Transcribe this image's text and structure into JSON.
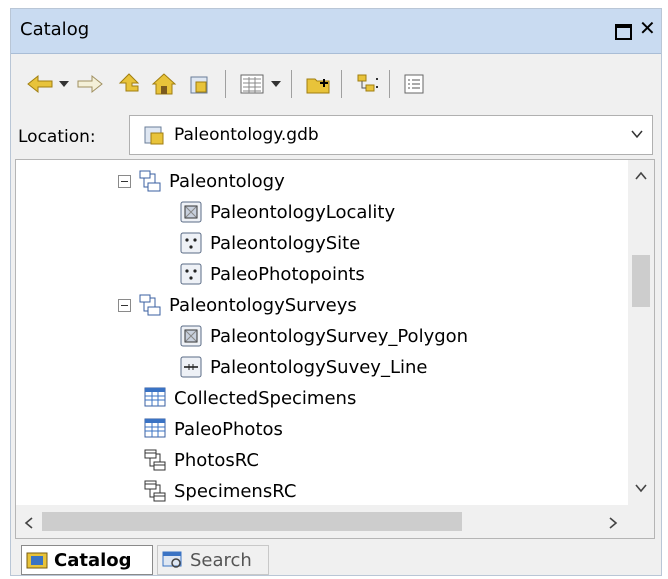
{
  "window": {
    "title": "Catalog"
  },
  "location": {
    "label": "Location:",
    "value": "Paleontology.gdb"
  },
  "tree": [
    {
      "label": "Paleontology",
      "icon": "feature-dataset-icon",
      "kind": "dataset"
    },
    {
      "label": "PaleontologyLocality",
      "icon": "polygon-feature-class-icon",
      "kind": "fc"
    },
    {
      "label": "PaleontologySite",
      "icon": "point-feature-class-icon",
      "kind": "fc"
    },
    {
      "label": "PaleoPhotopoints",
      "icon": "point-feature-class-icon",
      "kind": "fc"
    },
    {
      "label": "PaleontologySurveys",
      "icon": "feature-dataset-icon",
      "kind": "dataset"
    },
    {
      "label": "PaleontologySurvey_Polygon",
      "icon": "polygon-feature-class-icon",
      "kind": "fc"
    },
    {
      "label": "PaleontologySuvey_Line",
      "icon": "line-feature-class-icon",
      "kind": "fc"
    },
    {
      "label": "CollectedSpecimens",
      "icon": "table-icon",
      "kind": "table"
    },
    {
      "label": "PaleoPhotos",
      "icon": "table-icon",
      "kind": "table"
    },
    {
      "label": "PhotosRC",
      "icon": "relationship-class-icon",
      "kind": "table"
    },
    {
      "label": "SpecimensRC",
      "icon": "relationship-class-icon",
      "kind": "table"
    }
  ],
  "tabs": {
    "catalog": "Catalog",
    "search": "Search"
  },
  "colors": {
    "title_bar": "#c9dbf1",
    "arrow_yellow": "#e8c33a",
    "accent_blue": "#3a73c4"
  }
}
